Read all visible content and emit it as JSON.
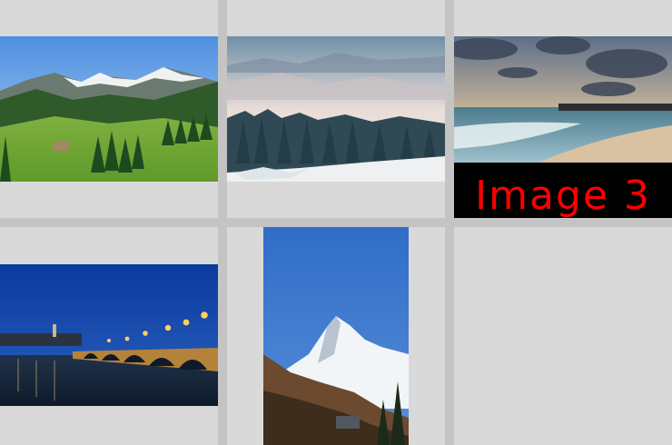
{
  "gallery": {
    "items": [
      {
        "name": "alpine-meadow"
      },
      {
        "name": "misty-forest"
      },
      {
        "name": "beach-sunset",
        "label": "Image  3"
      },
      {
        "name": "bridge-night"
      },
      {
        "name": "snow-peak"
      }
    ]
  },
  "colors": {
    "grid_line": "#c4c4c4",
    "cell_background": "#d9d9d9",
    "label_background": "#000000",
    "label_text": "#ff0000"
  }
}
